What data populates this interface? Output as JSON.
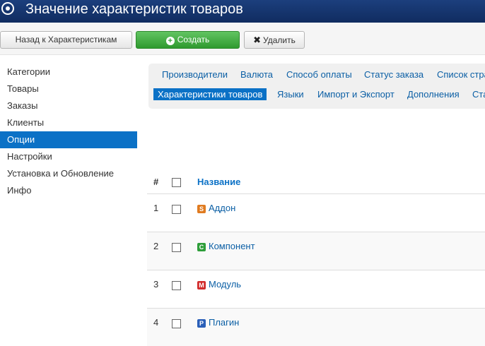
{
  "header": {
    "title": "Значение характеристик товаров",
    "icon": "target-icon"
  },
  "toolbar": {
    "back_label": "Назад к Характеристикам",
    "create_label": "Создать",
    "delete_label": "Удалить"
  },
  "sidebar": {
    "items": [
      {
        "label": "Категории"
      },
      {
        "label": "Товары"
      },
      {
        "label": "Заказы"
      },
      {
        "label": "Клиенты"
      },
      {
        "label": "Опции",
        "active": true
      },
      {
        "label": "Настройки"
      },
      {
        "label": "Установка и Обновление"
      },
      {
        "label": "Инфо"
      }
    ]
  },
  "submenu": {
    "row1": [
      "Производители",
      "Валюта",
      "Способ оплаты",
      "Статус заказа",
      "Список стра"
    ],
    "row2": [
      "Характеристики товаров",
      "Языки",
      "Импорт и Экспорт",
      "Дополнения",
      "Ста"
    ]
  },
  "table": {
    "headers": {
      "num": "#",
      "name": "Название"
    },
    "rows": [
      {
        "num": "1",
        "name": "Аддон",
        "icon": "addon-icon",
        "icon_color": "#e07b20",
        "icon_letter": "S"
      },
      {
        "num": "2",
        "name": "Компонент",
        "icon": "component-icon",
        "icon_color": "#2e9e3a",
        "icon_letter": "C"
      },
      {
        "num": "3",
        "name": "Модуль",
        "icon": "module-icon",
        "icon_color": "#d22d2d",
        "icon_letter": "M"
      },
      {
        "num": "4",
        "name": "Плагин",
        "icon": "plugin-icon",
        "icon_color": "#2a5fb8",
        "icon_letter": "P"
      }
    ]
  },
  "colors": {
    "accent": "#0b71c6",
    "header_bg": "#163770",
    "create_bg": "#46b046"
  }
}
